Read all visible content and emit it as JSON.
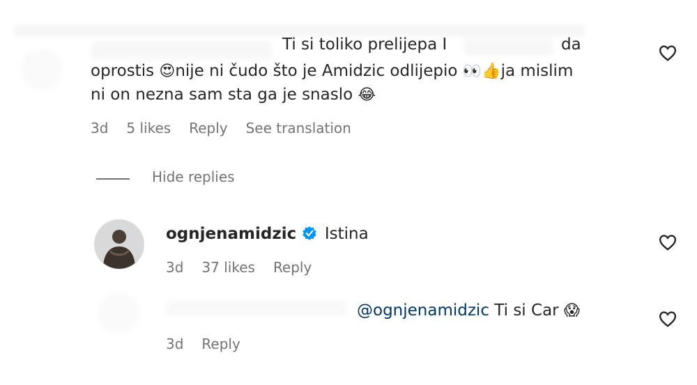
{
  "comment1": {
    "text_part1": "Ti si toliko prelijepa I",
    "text_part1_tail": "da",
    "line2_a": "oprostis",
    "emoji_heart_eyes": "😍",
    "line2_b": "nije ni čudo što je Amidzic odlijepio",
    "emoji_eyes": "👀",
    "emoji_thumbs": "👍",
    "line2_c": "ja mislim",
    "line3": "ni on nezna sam sta ga je snaslo",
    "emoji_tears": "😂",
    "time": "3d",
    "likes": "5 likes",
    "reply": "Reply",
    "translate": "See translation"
  },
  "hide_replies": "Hide replies",
  "reply1": {
    "username": "ognjenamidzic",
    "text": "Istina",
    "time": "3d",
    "likes": "37 likes",
    "reply": "Reply"
  },
  "reply2": {
    "mention": "@ognjenamidzic",
    "text": "Ti si Car",
    "emoji": "😱",
    "time": "3d",
    "reply": "Reply"
  },
  "colors": {
    "text": "#262626",
    "meta": "#737373",
    "mention": "#00376b",
    "verified": "#0095f6"
  },
  "icons": [
    "heart-icon",
    "verified-badge-icon"
  ]
}
